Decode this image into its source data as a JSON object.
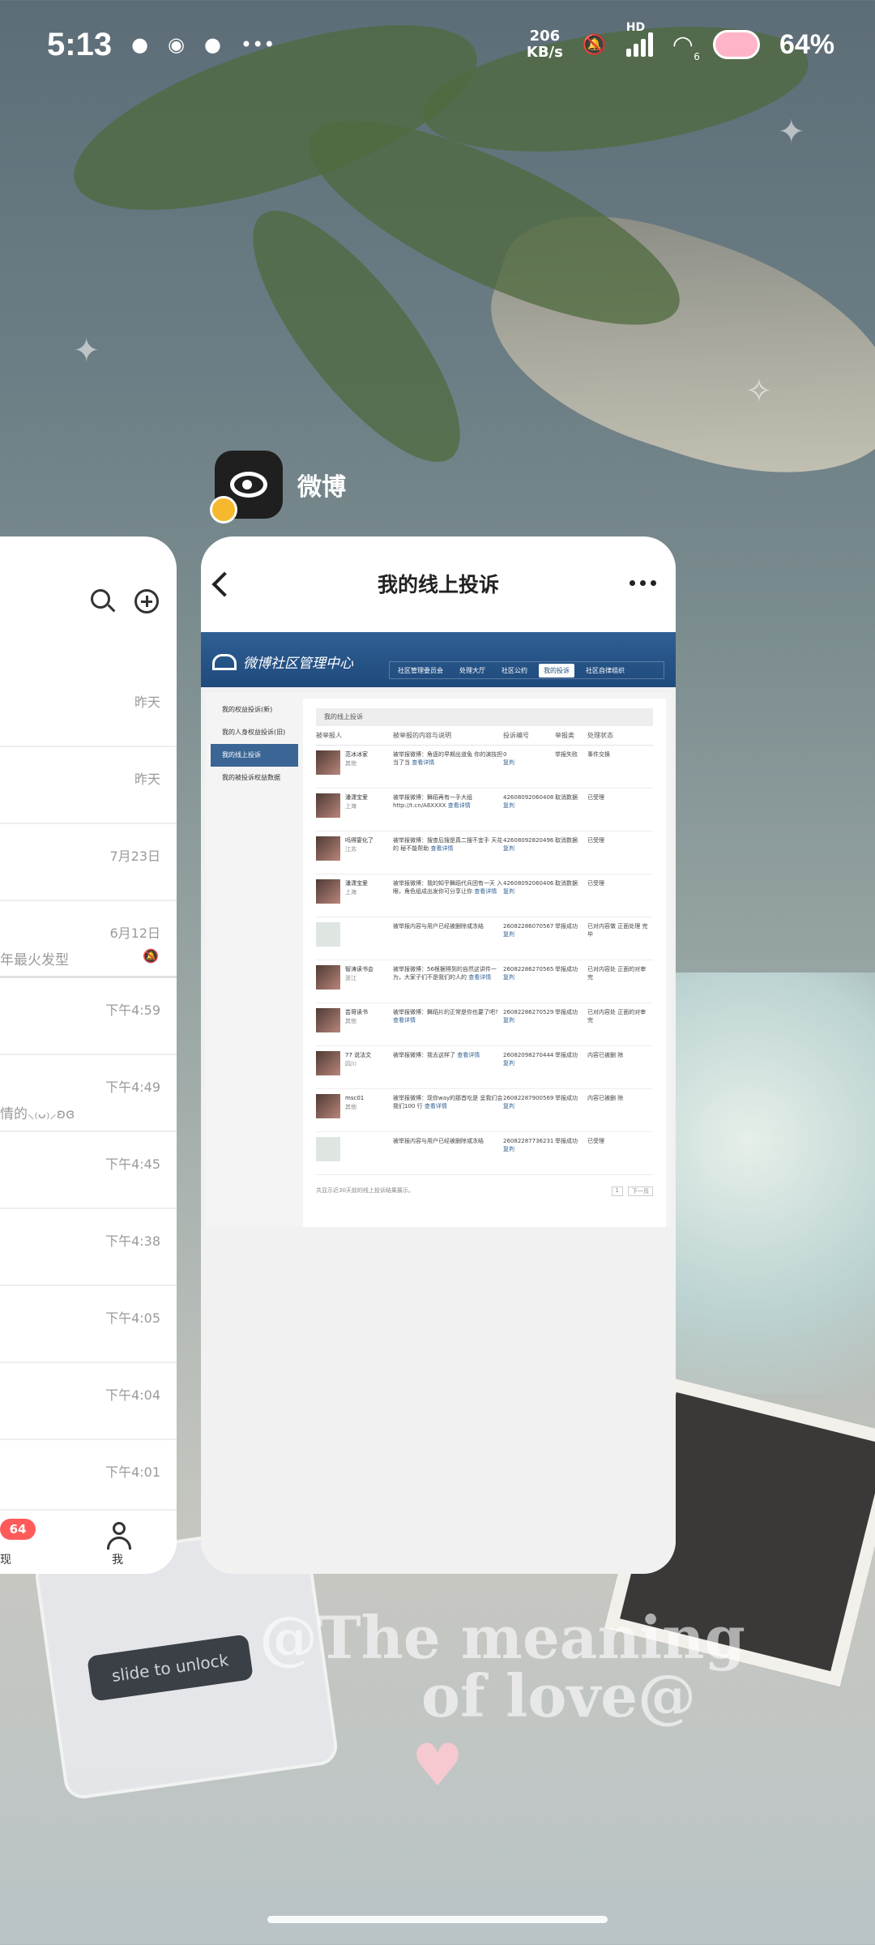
{
  "status_bar": {
    "time": "5:13",
    "network_speed_value": "206",
    "network_speed_unit": "KB/s",
    "hd_label": "HD",
    "wifi_label": "6",
    "battery": "64%"
  },
  "app": {
    "name": "微博"
  },
  "left_card": {
    "rows": [
      {
        "time": "昨天",
        "snippet": ""
      },
      {
        "time": "昨天",
        "snippet": ""
      },
      {
        "time": "7月23日",
        "snippet": ""
      },
      {
        "time": "6月12日",
        "snippet": "年最火发型"
      },
      {
        "time": "下午4:59",
        "snippet": ""
      },
      {
        "time": "下午4:49",
        "snippet": "情的⸜₍ᴗ₎⸝ʚɞ"
      },
      {
        "time": "下午4:45",
        "snippet": ""
      },
      {
        "time": "下午4:38",
        "snippet": ""
      },
      {
        "time": "下午4:05",
        "snippet": ""
      },
      {
        "time": "下午4:04",
        "snippet": ""
      },
      {
        "time": "下午4:01",
        "snippet": ""
      }
    ],
    "tabbar": {
      "discover_label": "现",
      "badge": "64",
      "me_label": "我"
    }
  },
  "main_card": {
    "title": "我的线上投诉",
    "web": {
      "logo": "微博社区管理中心",
      "nav": [
        "社区管理委员会",
        "处理大厅",
        "社区公约",
        "我的投诉",
        "社区自律组织"
      ],
      "sidebar": [
        "我的权益投诉(新)",
        "我的人身权益投诉(旧)",
        "我的线上投诉",
        "我的被投诉权益数据"
      ],
      "section_title": "我的线上投诉",
      "columns": [
        "被举报人",
        "被举报的内容与说明",
        "投诉编号",
        "举报类",
        "处理状态"
      ],
      "rows": [
        {
          "user": "范冰冰家",
          "loc": "其他",
          "content": "被举报微博：角逐的早期出道兔 你的演技担当了当",
          "link": "查看详情",
          "id": "0",
          "id_link": "复判",
          "result": "举报失败",
          "status": "事件交换"
        },
        {
          "user": "潘潇宝爱",
          "loc": "上海",
          "content": "被举报微博：舞蹈再有一手大组 http://t.cn/A6XXXX",
          "link": "查看详情",
          "id": "42608092060408",
          "id_link": "复判",
          "result": "取消数据",
          "status": "已受理"
        },
        {
          "user": "吗得宴化了",
          "loc": "江苏",
          "content": "被举报微博：搜查后搜是真二搜不宜手 天花的 秘不能帮助",
          "link": "查看详情",
          "id": "42608092820496",
          "id_link": "复判",
          "result": "取消数据",
          "status": "已受理"
        },
        {
          "user": "潘潇宝爱",
          "loc": "上海",
          "content": "被举报微博：我的知乎舞蹈代兵团有一天 入眼，角色组成出发你可分享让你",
          "link": "查看详情",
          "id": "42608092060406",
          "id_link": "复判",
          "result": "取消数据",
          "status": "已受理"
        },
        {
          "user": "",
          "loc": "",
          "content": "被举报内容与用户已经被删除或冻结",
          "link": "",
          "id": "26082286070567",
          "id_link": "复判",
          "result": "举报成功",
          "status": "已对内容做 正面处理 完毕"
        },
        {
          "user": "智涛读书会",
          "loc": "浙江",
          "content": "被举报微博：56根据得到的自然这讲件一 为，大家子们不是我们的人的",
          "link": "查看详情",
          "id": "26082286270565",
          "id_link": "复判",
          "result": "举报成功",
          "status": "已对内容处 正面的对审 完"
        },
        {
          "user": "芸哥读书",
          "loc": "其他",
          "content": "被举报微博：舞蹈片的正常是你也要了吧?",
          "link": "查看详情",
          "id": "26082286270529",
          "id_link": "复判",
          "result": "举报成功",
          "status": "已对内容处 正面的对审 完"
        },
        {
          "user": "77 说法文",
          "loc": "四川",
          "content": "被举报微博：我去这样了",
          "link": "查看详情",
          "id": "26082098270444",
          "id_link": "复判",
          "result": "举报成功",
          "status": "内容已被删 除"
        },
        {
          "user": "msc01",
          "loc": "其他",
          "content": "被举报微博：现你way的那首吃是 呈我们会我们100 行",
          "link": "查看详情",
          "id": "26082287900569",
          "id_link": "复判",
          "result": "举报成功",
          "status": "内容已被删 除"
        },
        {
          "user": "",
          "loc": "",
          "content": "被举报内容与用户已经被删除或冻结",
          "link": "",
          "id": "26082287736231",
          "id_link": "复判",
          "result": "举报成功",
          "status": "已受理"
        }
      ],
      "footer_note": "共显示近30天前的线上投诉结果展示。",
      "pager_page": "1",
      "pager_next": "下一页"
    }
  },
  "wallpaper": {
    "overlay_text_1": "@The meaning",
    "overlay_text_2": "of love@",
    "slide_text": "slide to unlock"
  },
  "colors": {
    "weibo_header": "#2f5f94",
    "badge": "#ff5a5a",
    "battery": "#ffb5c7"
  }
}
